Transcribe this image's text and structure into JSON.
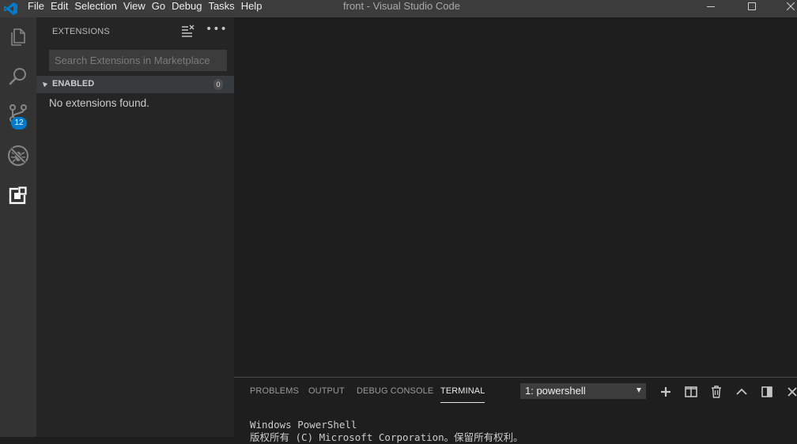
{
  "window": {
    "title": "front - Visual Studio Code",
    "controls": [
      "minimize",
      "maximize",
      "close"
    ]
  },
  "menu": [
    "File",
    "Edit",
    "Selection",
    "View",
    "Go",
    "Debug",
    "Tasks",
    "Help"
  ],
  "activity_bar": {
    "items": [
      {
        "name": "explorer",
        "icon": "files-icon"
      },
      {
        "name": "search",
        "icon": "search-icon"
      },
      {
        "name": "source-control",
        "icon": "source-control-icon",
        "badge": "12"
      },
      {
        "name": "debug",
        "icon": "debug-icon"
      },
      {
        "name": "extensions",
        "icon": "extensions-icon",
        "active": true
      }
    ]
  },
  "sidebar": {
    "title": "EXTENSIONS",
    "search_placeholder": "Search Extensions in Marketplace",
    "search_value": "",
    "section": {
      "label": "ENABLED",
      "count": "0"
    },
    "empty_message": "No extensions found."
  },
  "panel": {
    "tabs": [
      {
        "label": "PROBLEMS",
        "active": false
      },
      {
        "label": "OUTPUT",
        "active": false
      },
      {
        "label": "DEBUG CONSOLE",
        "active": false
      },
      {
        "label": "TERMINAL",
        "active": true
      }
    ],
    "terminal_select": "1: powershell",
    "actions": [
      "plus-icon",
      "split-icon",
      "trash-icon",
      "chevron-up-icon",
      "panel-layout-icon",
      "close-icon"
    ],
    "terminal_lines": [
      "Windows PowerShell",
      "版权所有 (C) Microsoft Corporation。保留所有权利。"
    ]
  },
  "colors": {
    "accent": "#007acc",
    "titlebar": "#3c3c3c",
    "activitybar": "#333333",
    "sidebar": "#252526",
    "editor": "#1e1e1e"
  }
}
